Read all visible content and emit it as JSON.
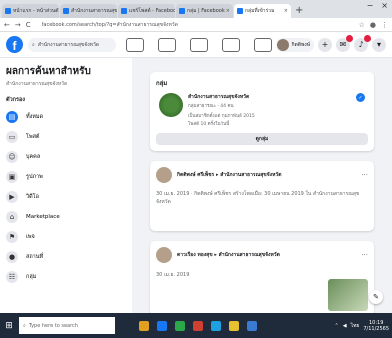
{
  "browser": {
    "tabs": [
      {
        "label": "หน้าแรก - หน้าส่วนตัว"
      },
      {
        "label": "สำนักงานสาธารณสุข"
      },
      {
        "label": "แชร์โพสต์ - Facebook"
      },
      {
        "label": "กลุ่ม | Facebook"
      },
      {
        "label": "กลุ่มที่เข้าร่วม"
      }
    ],
    "url": "facebook.com/search/top/?q=สำนักงานสาธารณสุขจังหวัด",
    "nav": {
      "back": "←",
      "forward": "→",
      "reload": "C"
    },
    "window_controls": {
      "minimize": "−",
      "close": "×"
    }
  },
  "fb": {
    "search_value": "สำนักงานสาธารณสุขจังหวัด",
    "profile_name": "กิตติพงษ์",
    "buttons": {
      "create": "+"
    }
  },
  "sidebar": {
    "title": "ผลการค้นหาสำหรับ",
    "subtitle": "สำนักงานสาธารณสุขจังหวัด",
    "section": "ตัวกรอง",
    "items": [
      {
        "label": "ทั้งหมด",
        "icon": "▤"
      },
      {
        "label": "โพสต์",
        "icon": "▭"
      },
      {
        "label": "บุคคล",
        "icon": "☺"
      },
      {
        "label": "รูปภาพ",
        "icon": "▣"
      },
      {
        "label": "วิดีโอ",
        "icon": "▶"
      },
      {
        "label": "Marketplace",
        "icon": "⌂"
      },
      {
        "label": "เพจ",
        "icon": "⚑"
      },
      {
        "label": "สถานที่",
        "icon": "●"
      },
      {
        "label": "กลุ่ม",
        "icon": "☷"
      }
    ]
  },
  "feed": {
    "group_card": {
      "label": "กลุ่ม",
      "name": "สำนักงานสาธารณสุขจังหวัด",
      "meta1": "กลุ่มสาธารณะ · 44 คน",
      "meta2": "เป็นสมาชิกตั้งแต่ กุมภาพันธ์ 2015",
      "meta3": "โพสต์ 10 ครั้งในวันนี้",
      "join": "ดูกลุ่ม"
    },
    "post1": {
      "author": "กิตติพงษ์ ศรีเพ็ชร ▸ สำนักงานสาธารณสุขจังหวัด",
      "date": "30 เม.ย. 2019",
      "text": "30 เม.ย. 2019 · กิตติพงษ์ ศรีเพ็ชร สร้างโพลเมื่อ: 30 เมษายน 2019 ใน สำนักงานสาธารณสุขจังหวัด"
    },
    "post2": {
      "author": "ดาวเรือง ทองสุข ▸ สำนักงานสาธารณสุขจังหวัด",
      "date": "30 เม.ย. 2019"
    }
  },
  "taskbar": {
    "search_placeholder": "Type here to search",
    "time": "10:19",
    "date": "7/11/2565",
    "tray_lang": "ไทย",
    "app_colors": [
      "#e0a020",
      "#1877f2",
      "#2aa84a",
      "#d04030",
      "#1fa0e0",
      "#e8c030",
      "#3a7ad0"
    ]
  }
}
